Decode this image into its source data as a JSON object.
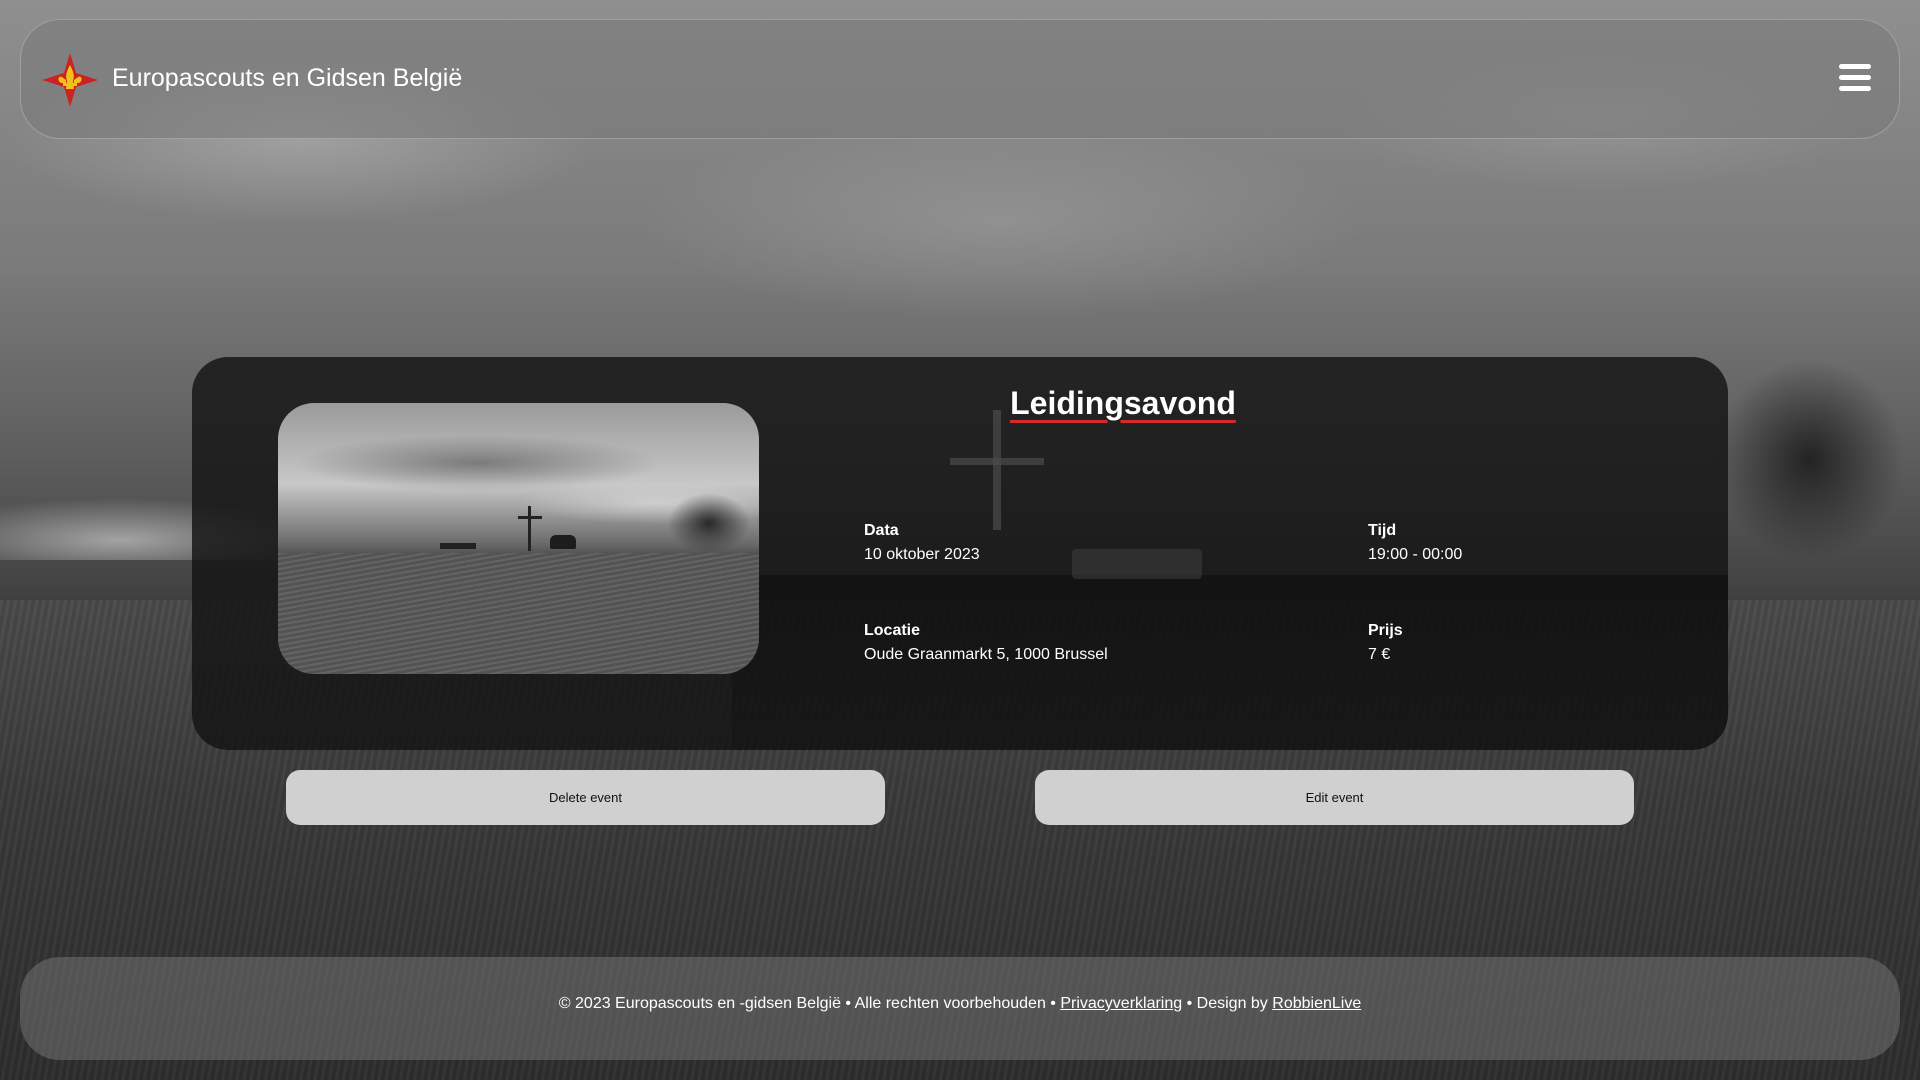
{
  "header": {
    "brand": "Europascouts en Gidsen België",
    "menu_icon": "hamburger-menu-icon",
    "logo_icon": "fleur-de-lis-cross-icon"
  },
  "event": {
    "title": "Leidingsavond",
    "date_label": "Data",
    "date_value": "10 oktober 2023",
    "time_label": "Tijd",
    "time_value": "19:00 - 00:00",
    "location_label": "Locatie",
    "location_value": "Oude Graanmarkt 5, 1000 Brussel",
    "price_label": "Prijs",
    "price_value": "7 €"
  },
  "actions": {
    "delete_label": "Delete event",
    "edit_label": "Edit event"
  },
  "footer": {
    "copyright": "© 2023 Europascouts en -gidsen België • Alle rechten voorbehouden •",
    "privacy_link": "Privacyverklaring",
    "design_prefix": "• Design by",
    "designer_link": "RobbienLive"
  },
  "colors": {
    "accent_red": "#d42a2a",
    "logo_yellow": "#f2c21b",
    "button_bg": "#d0d0d0"
  }
}
